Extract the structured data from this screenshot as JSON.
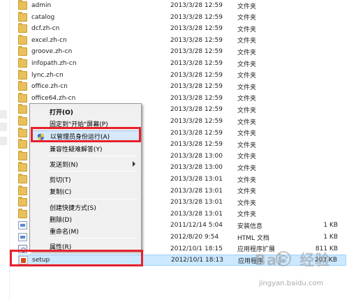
{
  "files": [
    {
      "name": "admin",
      "date": "2013/3/28 12:59",
      "type": "文件夹",
      "size": "",
      "icon": "folder-icon"
    },
    {
      "name": "catalog",
      "date": "2013/3/28 12:59",
      "type": "文件夹",
      "size": "",
      "icon": "folder-icon"
    },
    {
      "name": "dcf.zh-cn",
      "date": "2013/3/28 12:59",
      "type": "文件夹",
      "size": "",
      "icon": "folder-icon"
    },
    {
      "name": "excel.zh-cn",
      "date": "2013/3/28 12:59",
      "type": "文件夹",
      "size": "",
      "icon": "folder-icon"
    },
    {
      "name": "groove.zh-cn",
      "date": "2013/3/28 12:59",
      "type": "文件夹",
      "size": "",
      "icon": "folder-icon"
    },
    {
      "name": "infopath.zh-cn",
      "date": "2013/3/28 12:59",
      "type": "文件夹",
      "size": "",
      "icon": "folder-icon"
    },
    {
      "name": "lync.zh-cn",
      "date": "2013/3/28 12:59",
      "type": "文件夹",
      "size": "",
      "icon": "folder-icon"
    },
    {
      "name": "office.zh-cn",
      "date": "2013/3/28 12:59",
      "type": "文件夹",
      "size": "",
      "icon": "folder-icon"
    },
    {
      "name": "office64.zh-cn",
      "date": "2013/3/28 12:59",
      "type": "文件夹",
      "size": "",
      "icon": "folder-icon"
    },
    {
      "name": "",
      "date": "2013/3/28 12:59",
      "type": "文件夹",
      "size": "",
      "icon": "folder-icon"
    },
    {
      "name": "",
      "date": "2013/3/28 12:59",
      "type": "文件夹",
      "size": "",
      "icon": "folder-icon"
    },
    {
      "name": "",
      "date": "2013/3/28 12:59",
      "type": "文件夹",
      "size": "",
      "icon": "folder-icon"
    },
    {
      "name": "",
      "date": "2013/3/28 12:59",
      "type": "文件夹",
      "size": "",
      "icon": "folder-icon"
    },
    {
      "name": "",
      "date": "2013/3/28 13:00",
      "type": "文件夹",
      "size": "",
      "icon": "folder-icon"
    },
    {
      "name": "",
      "date": "2013/3/28 13:00",
      "type": "文件夹",
      "size": "",
      "icon": "folder-icon"
    },
    {
      "name": "",
      "date": "2013/3/28 13:01",
      "type": "文件夹",
      "size": "",
      "icon": "folder-icon"
    },
    {
      "name": "",
      "date": "2013/3/28 13:01",
      "type": "文件夹",
      "size": "",
      "icon": "folder-icon"
    },
    {
      "name": "",
      "date": "2013/3/28 13:01",
      "type": "文件夹",
      "size": "",
      "icon": "folder-icon"
    },
    {
      "name": "",
      "date": "2013/3/28 13:01",
      "type": "文件夹",
      "size": "",
      "icon": "folder-icon"
    },
    {
      "name": "",
      "date": "2011/12/14 5:04",
      "type": "安装信息",
      "size": "1 KB",
      "icon": "file-icon"
    },
    {
      "name": "",
      "date": "2012/8/20 9:54",
      "type": "HTML 文档",
      "size": "1 KB",
      "icon": "file-icon"
    },
    {
      "name": "",
      "date": "2012/10/1 18:15",
      "type": "应用程序扩展",
      "size": "811 KB",
      "icon": "ext-icon"
    },
    {
      "name": "setup",
      "date": "2012/10/1 18:13",
      "type": "应用程序",
      "size": "203 KB",
      "icon": "app-icon"
    }
  ],
  "context_menu": {
    "items": [
      {
        "label": "打开(O)",
        "bold": true
      },
      {
        "label": "固定到\"开始\"屏幕(P)"
      },
      {
        "label": "以管理员身份运行(A)",
        "icon": "uac-shield-icon",
        "highlighted": true
      },
      {
        "label": "兼容性疑难解答(Y)"
      },
      {
        "label": "发送到(N)",
        "submenu": true
      },
      {
        "label": "剪切(T)"
      },
      {
        "label": "复制(C)"
      },
      {
        "label": "创建快捷方式(S)"
      },
      {
        "label": "删除(D)"
      },
      {
        "label": "重命名(M)"
      },
      {
        "label": "属性(R)"
      }
    ]
  },
  "watermark": {
    "logo_left": "Bai",
    "logo_right": "经验",
    "url": "jingyan.baidu.com"
  },
  "colors": {
    "highlight_box": "#e8202a",
    "selection": "#cce8ff",
    "menu_hover": "#d6e8fa"
  }
}
